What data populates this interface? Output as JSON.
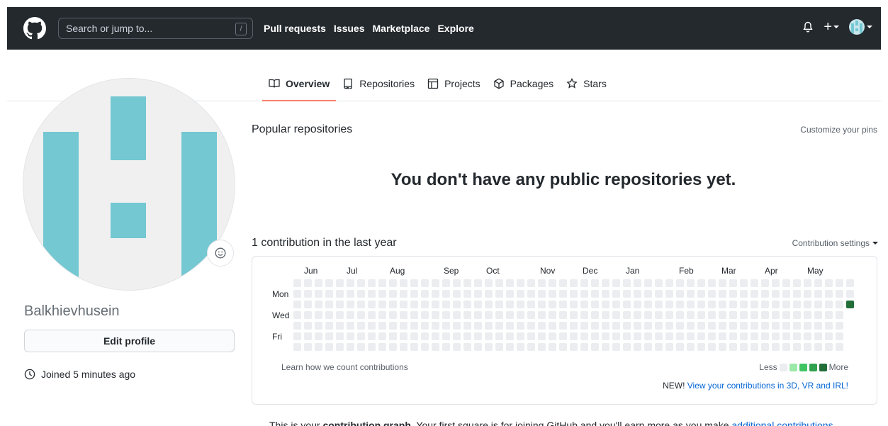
{
  "header": {
    "search_placeholder": "Search or jump to...",
    "slash_hint": "/",
    "nav": [
      "Pull requests",
      "Issues",
      "Marketplace",
      "Explore"
    ]
  },
  "tabs": [
    {
      "label": "Overview",
      "icon": "book-icon",
      "active": true
    },
    {
      "label": "Repositories",
      "icon": "repo-icon"
    },
    {
      "label": "Projects",
      "icon": "project-icon"
    },
    {
      "label": "Packages",
      "icon": "package-icon"
    },
    {
      "label": "Stars",
      "icon": "star-icon"
    }
  ],
  "profile": {
    "username": "Balkhievhusein",
    "edit_label": "Edit profile",
    "joined": "Joined 5 minutes ago",
    "avatar_color": "#73c8d2"
  },
  "main": {
    "popular_title": "Popular repositories",
    "customize_label": "Customize your pins",
    "empty_message": "You don't have any public repositories yet.",
    "contrib_title": "1 contribution in the last year",
    "contrib_settings": "Contribution settings",
    "months": [
      "Jun",
      "Jul",
      "Aug",
      "Sep",
      "Oct",
      "Nov",
      "Dec",
      "Jan",
      "Feb",
      "Mar",
      "Apr",
      "May"
    ],
    "day_labels": [
      "Mon",
      "Wed",
      "Fri"
    ],
    "learn_label": "Learn how we count contributions",
    "legend_less": "Less",
    "legend_more": "More",
    "new_prefix": "NEW!",
    "new_link": "View your contributions in 3D, VR and IRL!",
    "info_prefix": "This is your ",
    "info_bold": "contribution graph",
    "info_middle": ". Your first square is for joining GitHub and you'll earn more as you make ",
    "info_link": "additional contributions",
    "info_suffix": "."
  },
  "colors": {
    "header_bg": "#24292e",
    "empty_cell": "#ebedf0",
    "level_colors": [
      "#ebedf0",
      "#9be9a8",
      "#40c463",
      "#30a14e",
      "#216e39"
    ],
    "tab_accent": "#f9826c",
    "link": "#0366d6"
  }
}
